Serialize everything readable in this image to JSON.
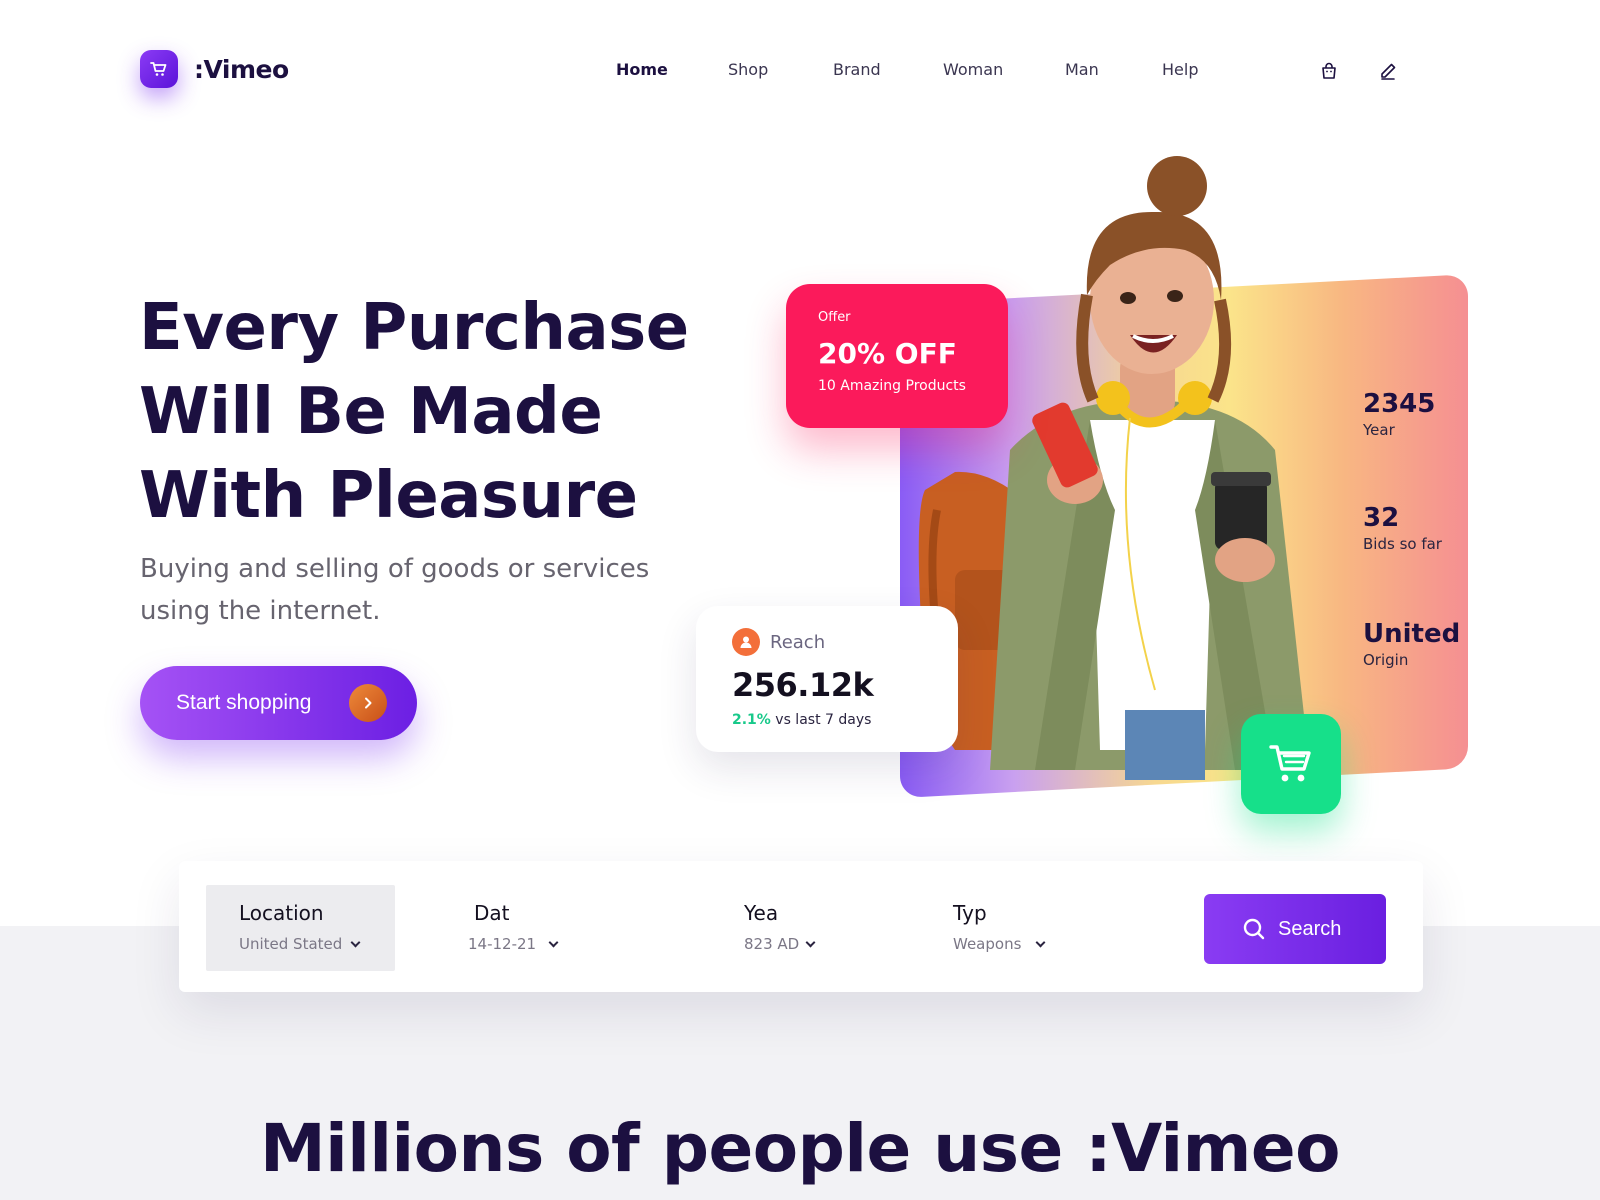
{
  "brand": {
    "name": ":Vimeo",
    "accent": "#7a2ef0"
  },
  "nav": {
    "items": [
      {
        "label": "Home",
        "active": true
      },
      {
        "label": "Shop"
      },
      {
        "label": "Brand"
      },
      {
        "label": "Woman"
      },
      {
        "label": "Man"
      },
      {
        "label": "Help"
      }
    ],
    "icons": [
      "shopping-bag-icon",
      "pencil-icon"
    ]
  },
  "hero": {
    "title_lines": [
      "Every Purchase",
      "Will Be Made",
      "With Pleasure"
    ],
    "subtitle": "Buying and selling of goods or services using the internet.",
    "cta_label": "Start shopping"
  },
  "offer": {
    "tag": "Offer",
    "headline": "20% OFF",
    "description": "10 Amazing Products",
    "color": "#fb1a5b"
  },
  "reach": {
    "label": "Reach",
    "value": "256.12k",
    "delta": "2.1%",
    "delta_suffix": " vs last 7 days",
    "delta_color": "#18c98a"
  },
  "stats": [
    {
      "value": "2345",
      "label": "Year"
    },
    {
      "value": "32",
      "label": "Bids so far"
    },
    {
      "value": "United",
      "label": "Origin"
    }
  ],
  "search": {
    "fields": [
      {
        "label": "Location",
        "value": "United Stated"
      },
      {
        "label": "Dat",
        "value": "14-12-21"
      },
      {
        "label": "Yea",
        "value": "823 AD"
      },
      {
        "label": "Typ",
        "value": "Weapons"
      }
    ],
    "button_label": "Search"
  },
  "section_heading": "Millions of people use :Vimeo"
}
